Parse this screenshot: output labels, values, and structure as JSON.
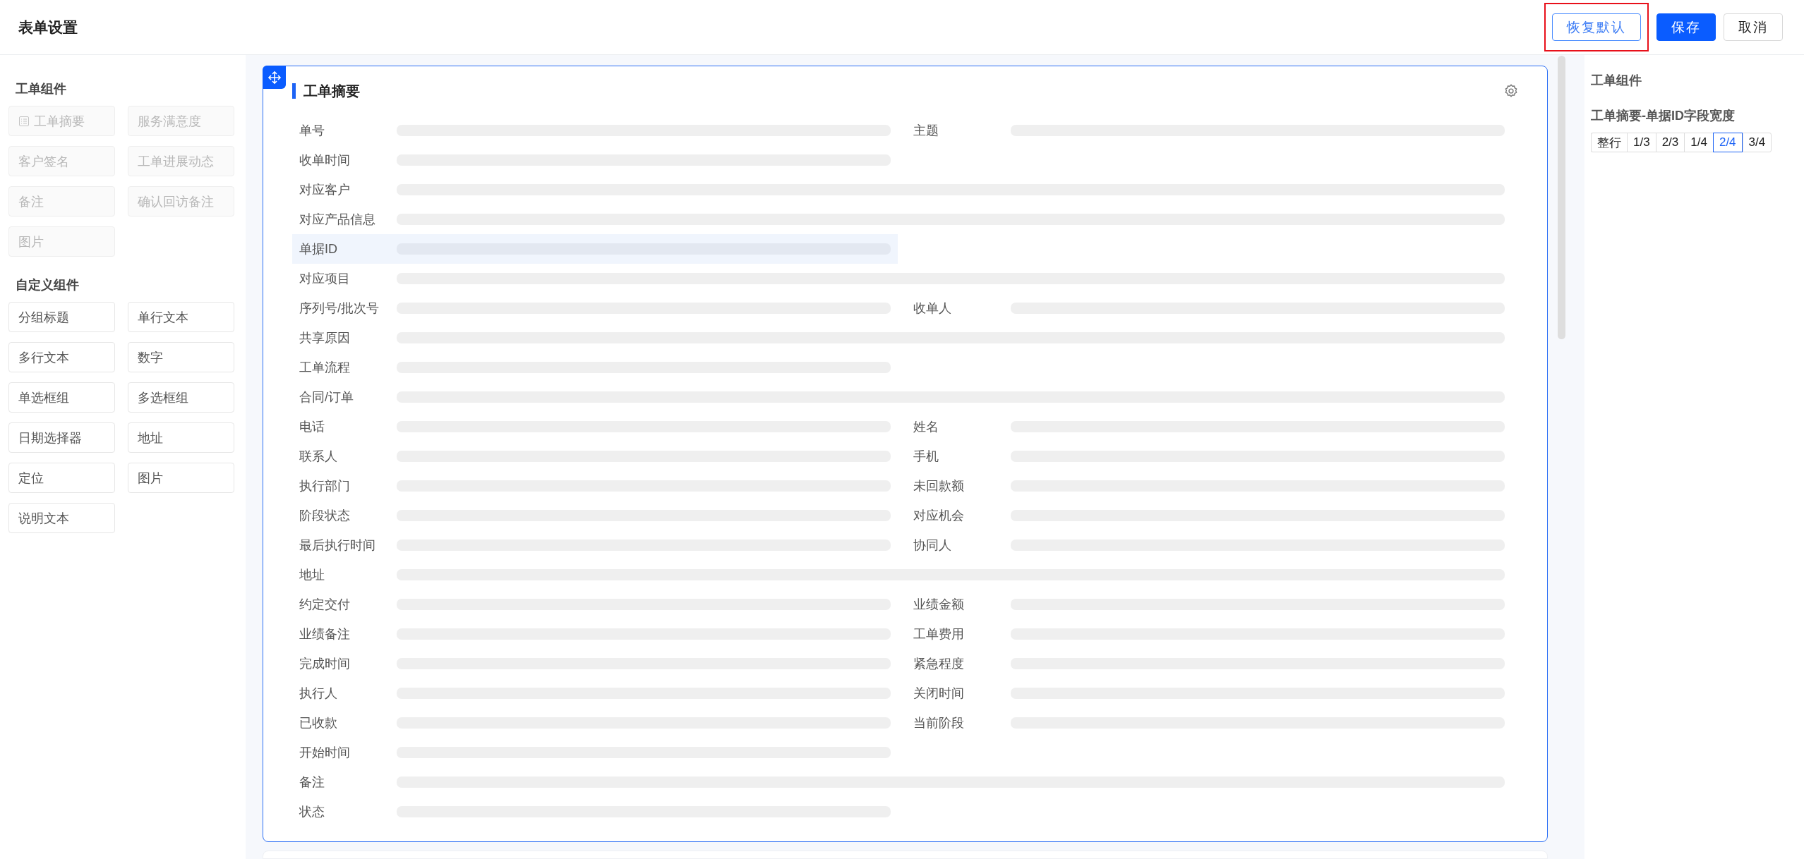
{
  "header": {
    "title": "表单设置",
    "buttons": [
      {
        "label": "恢复默认",
        "kind": "outline",
        "highlighted": true
      },
      {
        "label": "保存",
        "kind": "primary",
        "highlighted": false
      },
      {
        "label": "取消",
        "kind": "default",
        "highlighted": false
      }
    ]
  },
  "sidebar": {
    "groups": [
      {
        "title": "工单组件",
        "items": [
          {
            "label": "工单摘要",
            "disabled": true,
            "kind": "icon"
          },
          {
            "label": "服务满意度",
            "disabled": true
          },
          {
            "label": "客户签名",
            "disabled": true
          },
          {
            "label": "工单进展动态",
            "disabled": true
          },
          {
            "label": "备注",
            "disabled": true
          },
          {
            "label": "确认回访备注",
            "disabled": true
          },
          {
            "label": "图片",
            "disabled": true
          }
        ]
      },
      {
        "title": "自定义组件",
        "items": [
          {
            "label": "分组标题",
            "disabled": false
          },
          {
            "label": "单行文本",
            "disabled": false
          },
          {
            "label": "多行文本",
            "disabled": false
          },
          {
            "label": "数字",
            "disabled": false
          },
          {
            "label": "单选框组",
            "disabled": false
          },
          {
            "label": "多选框组",
            "disabled": false
          },
          {
            "label": "日期选择器",
            "disabled": false
          },
          {
            "label": "地址",
            "disabled": false
          },
          {
            "label": "定位",
            "disabled": false
          },
          {
            "label": "图片",
            "disabled": false
          },
          {
            "label": "说明文本",
            "disabled": false
          }
        ]
      }
    ]
  },
  "card": {
    "title": "工单摘要",
    "fields": [
      {
        "label": "单号",
        "kind": "half",
        "selected": false
      },
      {
        "label": "主题",
        "kind": "half",
        "selected": false
      },
      {
        "label": "收单时间",
        "kind": "half",
        "selected": false
      },
      {
        "label": "对应客户",
        "kind": "full",
        "selected": false
      },
      {
        "label": "对应产品信息",
        "kind": "full",
        "selected": false
      },
      {
        "label": "单据ID",
        "kind": "half",
        "selected": true
      },
      {
        "label": "对应项目",
        "kind": "full",
        "selected": false
      },
      {
        "label": "序列号/批次号",
        "kind": "half",
        "selected": false
      },
      {
        "label": "收单人",
        "kind": "half",
        "selected": false
      },
      {
        "label": "共享原因",
        "kind": "full",
        "selected": false
      },
      {
        "label": "工单流程",
        "kind": "half",
        "selected": false
      },
      {
        "label": "合同/订单",
        "kind": "full",
        "selected": false
      },
      {
        "label": "电话",
        "kind": "half",
        "selected": false
      },
      {
        "label": "姓名",
        "kind": "half",
        "selected": false
      },
      {
        "label": "联系人",
        "kind": "half",
        "selected": false
      },
      {
        "label": "手机",
        "kind": "half",
        "selected": false
      },
      {
        "label": "执行部门",
        "kind": "half",
        "selected": false
      },
      {
        "label": "未回款额",
        "kind": "half",
        "selected": false
      },
      {
        "label": "阶段状态",
        "kind": "half",
        "selected": false
      },
      {
        "label": "对应机会",
        "kind": "half",
        "selected": false
      },
      {
        "label": "最后执行时间",
        "kind": "half",
        "selected": false
      },
      {
        "label": "协同人",
        "kind": "half",
        "selected": false
      },
      {
        "label": "地址",
        "kind": "full",
        "selected": false
      },
      {
        "label": "约定交付",
        "kind": "half",
        "selected": false
      },
      {
        "label": "业绩金额",
        "kind": "half",
        "selected": false
      },
      {
        "label": "业绩备注",
        "kind": "half",
        "selected": false
      },
      {
        "label": "工单费用",
        "kind": "half",
        "selected": false
      },
      {
        "label": "完成时间",
        "kind": "half",
        "selected": false
      },
      {
        "label": "紧急程度",
        "kind": "half",
        "selected": false
      },
      {
        "label": "执行人",
        "kind": "half",
        "selected": false
      },
      {
        "label": "关闭时间",
        "kind": "half",
        "selected": false
      },
      {
        "label": "已收款",
        "kind": "half",
        "selected": false
      },
      {
        "label": "当前阶段",
        "kind": "half",
        "selected": false
      },
      {
        "label": "开始时间",
        "kind": "half",
        "selected": false
      },
      {
        "label": "备注",
        "kind": "full",
        "selected": false
      },
      {
        "label": "状态",
        "kind": "half",
        "selected": false
      }
    ]
  },
  "right_panel": {
    "title": "工单组件",
    "setting_title": "工单摘要-单据ID字段宽度",
    "options": [
      {
        "label": "整行",
        "selected": false
      },
      {
        "label": "1/3",
        "selected": false
      },
      {
        "label": "2/3",
        "selected": false
      },
      {
        "label": "1/4",
        "selected": false
      },
      {
        "label": "2/4",
        "selected": true
      },
      {
        "label": "3/4",
        "selected": false
      }
    ]
  }
}
